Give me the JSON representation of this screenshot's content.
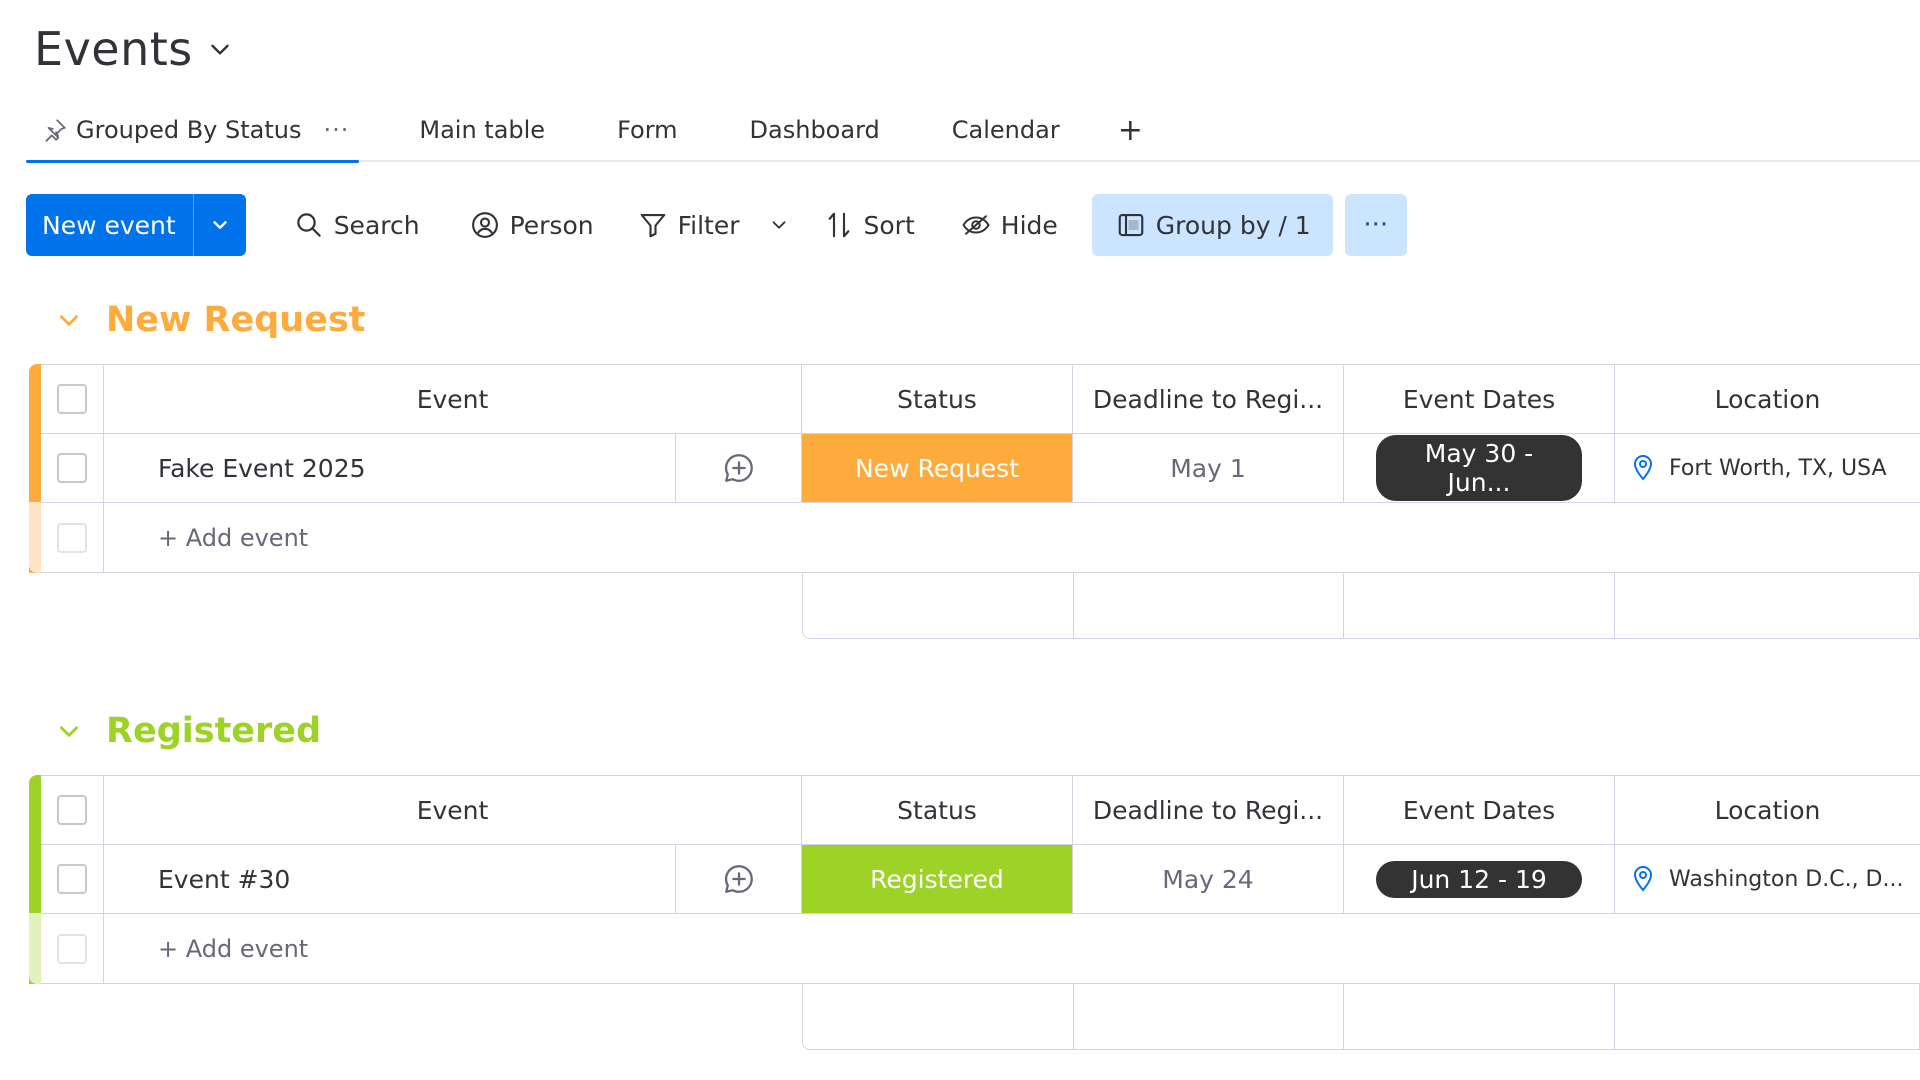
{
  "board": {
    "title": "Events"
  },
  "tabs": [
    {
      "label": "Grouped By Status",
      "active": true
    },
    {
      "label": "Main table"
    },
    {
      "label": "Form"
    },
    {
      "label": "Dashboard"
    },
    {
      "label": "Calendar"
    }
  ],
  "tab_add": "+",
  "tab_more": "···",
  "toolbar": {
    "new_label": "New event",
    "search": "Search",
    "person": "Person",
    "filter": "Filter",
    "sort": "Sort",
    "hide": "Hide",
    "group_by": "Group by / 1",
    "more": "···"
  },
  "columns": {
    "event": "Event",
    "status": "Status",
    "deadline": "Deadline to Regi...",
    "dates": "Event Dates",
    "location": "Location"
  },
  "groups": [
    {
      "title": "New Request",
      "color": "#fdab3d",
      "light_color": "#fee4c4",
      "items": [
        {
          "event": "Fake Event 2025",
          "status": "New Request",
          "deadline": "May 1",
          "dates": "May 30 - Jun...",
          "location": "Fort Worth, TX, USA"
        }
      ],
      "add_label": "+ Add event"
    },
    {
      "title": "Registered",
      "color": "#9cd326",
      "light_color": "#e1f2be",
      "items": [
        {
          "event": "Event #30",
          "status": "Registered",
          "deadline": "May 24",
          "dates": "Jun 12 - 19",
          "location": "Washington D.C., D..."
        }
      ],
      "add_label": "+ Add event"
    }
  ]
}
